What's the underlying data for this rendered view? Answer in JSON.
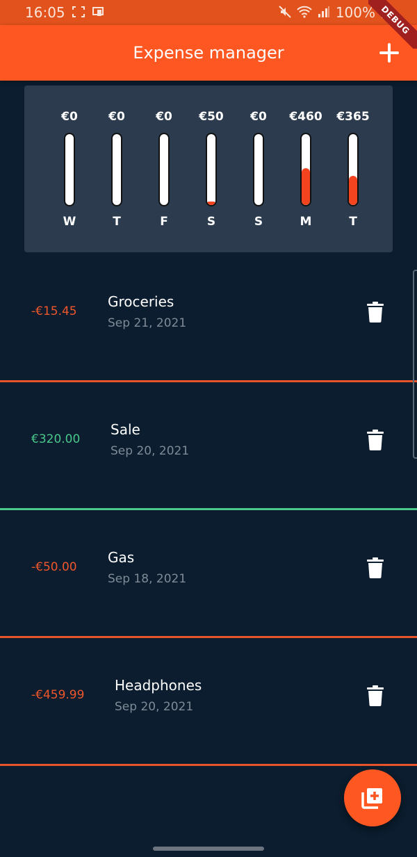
{
  "status_bar": {
    "time": "16:05",
    "battery": "100%",
    "icons": [
      "screenshot-icon",
      "cast-icon",
      "mute-icon",
      "wifi-icon",
      "signal-icon",
      "battery-icon"
    ]
  },
  "app_bar": {
    "title": "Expense manager",
    "action_icon": "plus-icon",
    "debug_banner": "DEBUG",
    "color": "#ff5722"
  },
  "weekly_chart": {
    "bars": [
      {
        "day": "W",
        "amount": "€0",
        "fill": 0.0
      },
      {
        "day": "T",
        "amount": "€0",
        "fill": 0.0
      },
      {
        "day": "F",
        "amount": "€0",
        "fill": 0.0
      },
      {
        "day": "S",
        "amount": "€50",
        "fill": 0.05
      },
      {
        "day": "S",
        "amount": "€0",
        "fill": 0.0
      },
      {
        "day": "M",
        "amount": "€460",
        "fill": 0.52
      },
      {
        "day": "T",
        "amount": "€365",
        "fill": 0.41
      }
    ],
    "fill_color": "#f4431f"
  },
  "transactions": [
    {
      "amount": "-€15.45",
      "title": "Groceries",
      "date": "Sep 21, 2021",
      "type": "expense"
    },
    {
      "amount": "€320.00",
      "title": "Sale",
      "date": "Sep 20, 2021",
      "type": "income"
    },
    {
      "amount": "-€50.00",
      "title": "Gas",
      "date": "Sep 18, 2021",
      "type": "expense"
    },
    {
      "amount": "-€459.99",
      "title": "Headphones",
      "date": "Sep 20, 2021",
      "type": "expense"
    }
  ],
  "colors": {
    "background": "#0b1d2e",
    "expense": "#f0562b",
    "income": "#49c98b"
  },
  "fab": {
    "icon": "add-to-library-icon"
  }
}
